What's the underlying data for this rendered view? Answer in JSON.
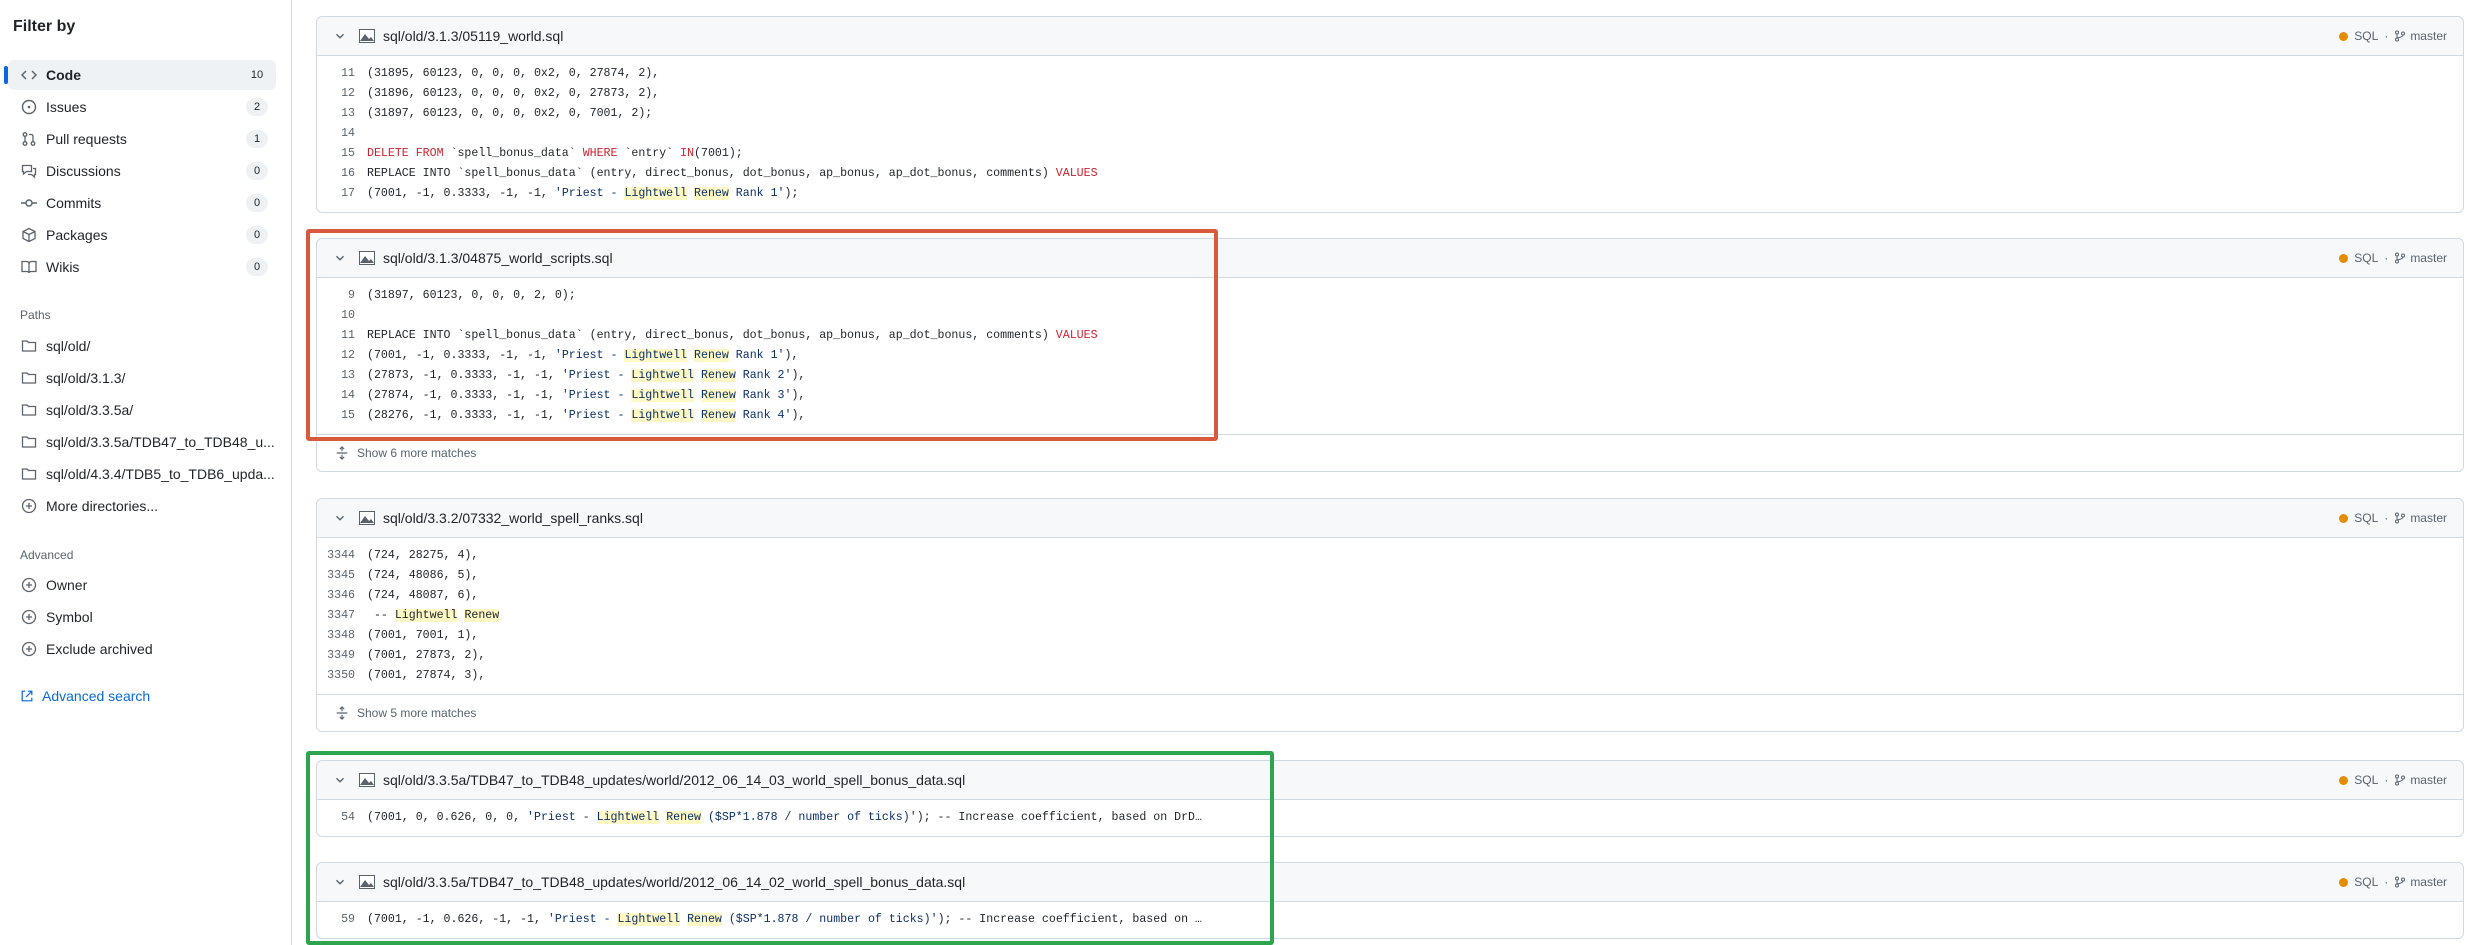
{
  "sidebar": {
    "title": "Filter by",
    "items": [
      {
        "label": "Code",
        "count": "10",
        "icon": "code-icon"
      },
      {
        "label": "Issues",
        "count": "2",
        "icon": "issue-icon"
      },
      {
        "label": "Pull requests",
        "count": "1",
        "icon": "pull-request-icon"
      },
      {
        "label": "Discussions",
        "count": "0",
        "icon": "discussion-icon"
      },
      {
        "label": "Commits",
        "count": "0",
        "icon": "commit-icon"
      },
      {
        "label": "Packages",
        "count": "0",
        "icon": "package-icon"
      },
      {
        "label": "Wikis",
        "count": "0",
        "icon": "book-icon"
      }
    ],
    "paths_heading": "Paths",
    "paths": [
      "sql/old/",
      "sql/old/3.1.3/",
      "sql/old/3.3.5a/",
      "sql/old/3.3.5a/TDB47_to_TDB48_u...",
      "sql/old/4.3.4/TDB5_to_TDB6_upda..."
    ],
    "more_dirs": "More directories...",
    "advanced_heading": "Advanced",
    "advanced": [
      "Owner",
      "Symbol",
      "Exclude archived"
    ],
    "advanced_search": "Advanced search"
  },
  "results": [
    {
      "path": "sql/old/3.1.3/05119_world.sql",
      "language": "SQL",
      "branch": "master",
      "lines": [
        {
          "n": "11",
          "t": "(31895, 60123, 0, 0, 0, 0x2, 0, 27874, 2),"
        },
        {
          "n": "12",
          "t": "(31896, 60123, 0, 0, 0, 0x2, 0, 27873, 2),"
        },
        {
          "n": "13",
          "t": "(31897, 60123, 0, 0, 0, 0x2, 0, 7001, 2);"
        },
        {
          "n": "14",
          "t": ""
        },
        {
          "n": "15",
          "t": "DELETE FROM `spell_bonus_data` WHERE `entry` IN(7001);"
        },
        {
          "n": "16",
          "t": "REPLACE INTO `spell_bonus_data` (entry, direct_bonus, dot_bonus, ap_bonus, ap_dot_bonus, comments) VALUES"
        },
        {
          "n": "17",
          "t": "(7001, -1, 0.3333, -1, -1, 'Priest - Lightwell Renew Rank 1');"
        }
      ],
      "more": ""
    },
    {
      "path": "sql/old/3.1.3/04875_world_scripts.sql",
      "language": "SQL",
      "branch": "master",
      "lines": [
        {
          "n": "9",
          "t": "(31897, 60123, 0, 0, 0, 2, 0);"
        },
        {
          "n": "10",
          "t": ""
        },
        {
          "n": "11",
          "t": "REPLACE INTO `spell_bonus_data` (entry, direct_bonus, dot_bonus, ap_bonus, ap_dot_bonus, comments) VALUES"
        },
        {
          "n": "12",
          "t": "(7001, -1, 0.3333, -1, -1, 'Priest - Lightwell Renew Rank 1'),"
        },
        {
          "n": "13",
          "t": "(27873, -1, 0.3333, -1, -1, 'Priest - Lightwell Renew Rank 2'),"
        },
        {
          "n": "14",
          "t": "(27874, -1, 0.3333, -1, -1, 'Priest - Lightwell Renew Rank 3'),"
        },
        {
          "n": "15",
          "t": "(28276, -1, 0.3333, -1, -1, 'Priest - Lightwell Renew Rank 4'),"
        }
      ],
      "more": "Show 6 more matches"
    },
    {
      "path": "sql/old/3.3.2/07332_world_spell_ranks.sql",
      "language": "SQL",
      "branch": "master",
      "lines": [
        {
          "n": "3344",
          "t": "(724, 28275, 4),"
        },
        {
          "n": "3345",
          "t": "(724, 48086, 5),"
        },
        {
          "n": "3346",
          "t": "(724, 48087, 6),"
        },
        {
          "n": "3347",
          "t": " -- Lightwell Renew"
        },
        {
          "n": "3348",
          "t": "(7001, 7001, 1),"
        },
        {
          "n": "3349",
          "t": "(7001, 27873, 2),"
        },
        {
          "n": "3350",
          "t": "(7001, 27874, 3),"
        }
      ],
      "more": "Show 5 more matches"
    },
    {
      "path": "sql/old/3.3.5a/TDB47_to_TDB48_updates/world/2012_06_14_03_world_spell_bonus_data.sql",
      "language": "SQL",
      "branch": "master",
      "lines": [
        {
          "n": "54",
          "t": "(7001, 0, 0.626, 0, 0, 'Priest - Lightwell Renew ($SP*1.878 / number of ticks)'); -- Increase coefficient, based on DrD…"
        }
      ],
      "more": ""
    },
    {
      "path": "sql/old/3.3.5a/TDB47_to_TDB48_updates/world/2012_06_14_02_world_spell_bonus_data.sql",
      "language": "SQL",
      "branch": "master",
      "lines": [
        {
          "n": "59",
          "t": "(7001, -1, 0.626, -1, -1, 'Priest - Lightwell Renew ($SP*1.878 / number of ticks)'); -- Increase coefficient, based on …"
        }
      ],
      "more": ""
    }
  ],
  "highlight_terms": [
    "Lightwell",
    "Renew"
  ],
  "colors": {
    "accent": "#0969da",
    "red_box": "#d9593d",
    "green_box": "#2da44e",
    "highlight": "#fff8c5",
    "sql_dot": "#e38c00"
  }
}
